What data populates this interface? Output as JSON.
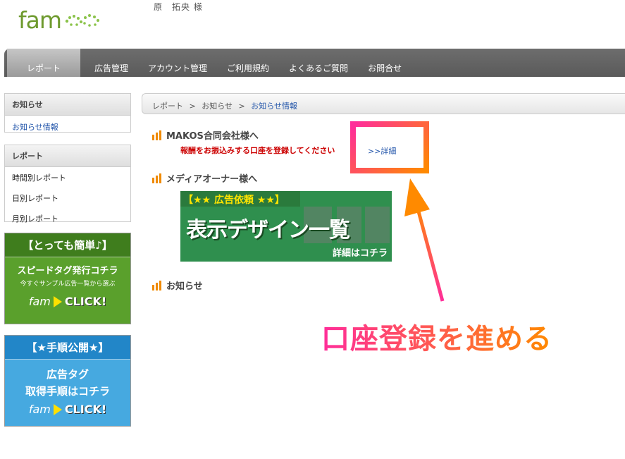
{
  "header": {
    "logo_text": "fam",
    "user_name": "原　拓央 様"
  },
  "nav": {
    "items": [
      {
        "label": "レポート",
        "active": true
      },
      {
        "label": "広告管理"
      },
      {
        "label": "アカウント管理"
      },
      {
        "label": "ご利用規約"
      },
      {
        "label": "よくあるご質問"
      },
      {
        "label": "お問合せ"
      }
    ]
  },
  "sidebar": {
    "news": {
      "heading": "お知らせ",
      "link": "お知らせ情報"
    },
    "reports": {
      "heading": "レポート",
      "items": [
        "時間別レポート",
        "日別レポート",
        "月別レポート"
      ]
    },
    "banner_speed": {
      "title": "【とっても簡単♪】",
      "line1": "スピードタグ発行コチラ",
      "line2": "今すぐサンプル広告一覧から選ぶ",
      "logo": "fam",
      "click": "CLICK!"
    },
    "banner_guide": {
      "title": "【★手順公開★】",
      "line1": "広告タグ",
      "line2": "取得手順はコチラ",
      "logo": "fam",
      "click": "CLICK!"
    }
  },
  "breadcrumb": {
    "items": [
      "レポート",
      "お知らせ"
    ],
    "separator": ">",
    "current": "お知らせ情報"
  },
  "content": {
    "section1": {
      "title": "MAKOS合同会社様へ",
      "notice": "報酬をお振込みする口座を登録してください",
      "detail_link": ">>詳細"
    },
    "section2": {
      "title": "メディアオーナー様へ",
      "banner_top": "【★★ 広告依頼 ★★】",
      "banner_main": "表示デザイン一覧",
      "banner_sub": "詳細はコチラ"
    },
    "section3": {
      "title": "お知らせ"
    }
  },
  "annotation": {
    "text": "口座登録を進める"
  },
  "colors": {
    "accent_orange": "#f08a00",
    "link_blue": "#2255aa",
    "warning_red": "#cc0000",
    "annotation_pink": "#ff2d9a"
  }
}
